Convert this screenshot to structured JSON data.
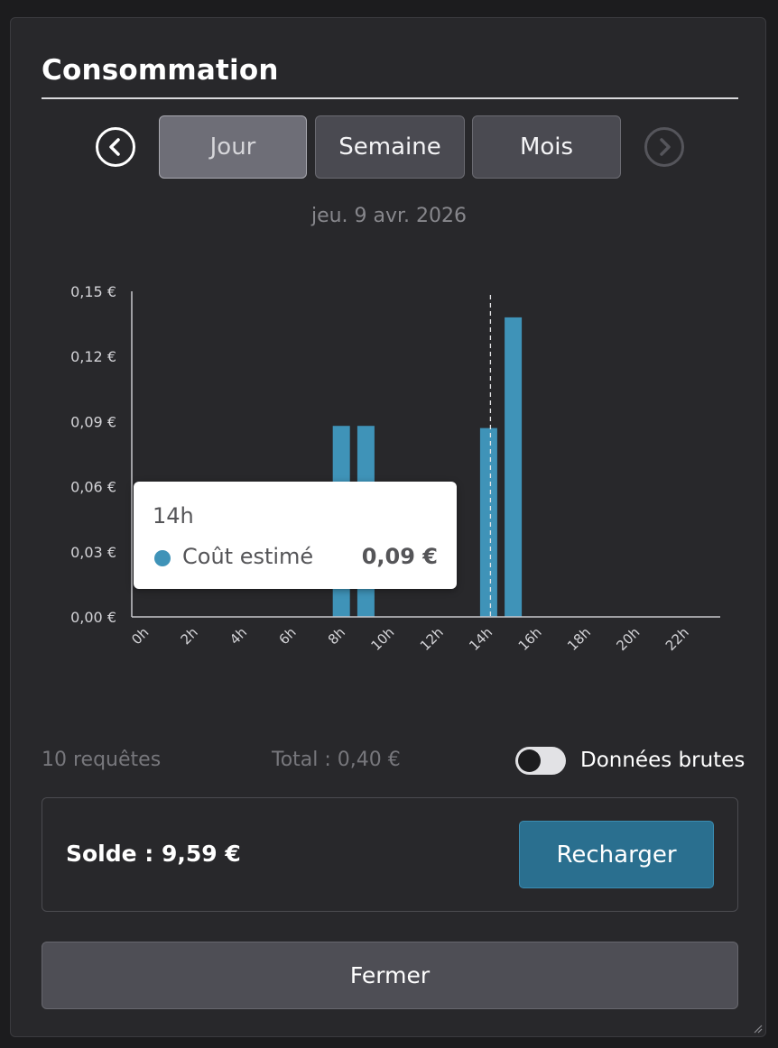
{
  "dialog": {
    "title": "Consommation",
    "date": "jeu. 9 avr. 2026"
  },
  "nav": {
    "prev_icon": "chevron-left-circle",
    "next_icon": "chevron-right-circle",
    "tabs": [
      {
        "label": "Jour",
        "active": true
      },
      {
        "label": "Semaine",
        "active": false
      },
      {
        "label": "Mois",
        "active": false
      }
    ]
  },
  "chart_data": {
    "type": "bar",
    "x": [
      0,
      1,
      2,
      3,
      4,
      5,
      6,
      7,
      8,
      9,
      10,
      11,
      12,
      13,
      14,
      15,
      16,
      17,
      18,
      19,
      20,
      21,
      22,
      23
    ],
    "values": [
      0,
      0,
      0,
      0,
      0,
      0,
      0,
      0,
      0.088,
      0.088,
      0,
      0,
      0,
      0,
      0.087,
      0.138,
      0,
      0,
      0,
      0,
      0,
      0,
      0,
      0
    ],
    "ylim": [
      0,
      0.15
    ],
    "yticks": [
      "0,00 €",
      "0,03 €",
      "0,06 €",
      "0,09 €",
      "0,12 €",
      "0,15 €"
    ],
    "xticks": [
      "0h",
      "2h",
      "4h",
      "6h",
      "8h",
      "10h",
      "12h",
      "14h",
      "16h",
      "18h",
      "20h",
      "22h"
    ],
    "series_color": "#3f93b8",
    "highlight_hour": 14,
    "grid": false
  },
  "tooltip": {
    "title": "14h",
    "label": "Coût estimé",
    "value": "0,09 €"
  },
  "stats": {
    "requests": "10 requêtes",
    "total": "Total : 0,40 €"
  },
  "raw_toggle": {
    "label": "Données brutes",
    "on": false
  },
  "balance": {
    "text": "Solde : 9,59 €",
    "recharge_label": "Recharger"
  },
  "close_label": "Fermer",
  "colors": {
    "accent": "#2a6f8f",
    "bar": "#3f93b8",
    "panel": "#28282b"
  }
}
